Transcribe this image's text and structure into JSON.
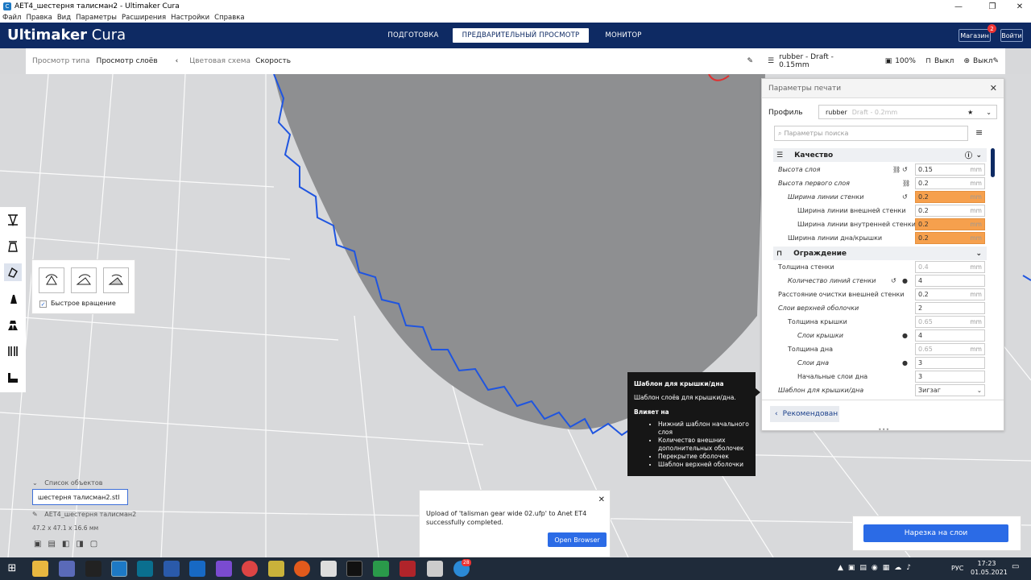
{
  "window": {
    "title": "AET4_шестерня талисман2 - Ultimaker Cura"
  },
  "menu": [
    "Файл",
    "Правка",
    "Вид",
    "Параметры",
    "Расширения",
    "Настройки",
    "Справка"
  ],
  "brand": {
    "name_bold": "Ultimaker",
    "name_light": "Cura"
  },
  "nav": {
    "prepare": "ПОДГОТОВКА",
    "preview": "ПРЕДВАРИТЕЛЬНЫЙ ПРОСМОТР",
    "monitor": "МОНИТОР"
  },
  "header_buttons": {
    "shop": "Магазин",
    "login": "Войти",
    "badge": "2"
  },
  "viewbar": {
    "view_type_label": "Просмотр типа",
    "view_type_value": "Просмотр слоёв",
    "scheme_label": "Цветовая схема",
    "scheme_value": "Скорость"
  },
  "printbar": {
    "profile": "rubber - Draft - 0.15mm",
    "infill": "100%",
    "support": "Выкл",
    "adhesion": "Выкл"
  },
  "settings": {
    "header": "Параметры печати",
    "profile_label": "Профиль",
    "profile_value": "rubber",
    "profile_sub": "Draft - 0.2mm",
    "search_placeholder": "Параметры поиска",
    "cat_quality": "Качество",
    "cat_walls": "Ограждение",
    "recommended": "Рекомендован",
    "rows": [
      {
        "name": "Высота слоя",
        "value": "0.15",
        "unit": "mm"
      },
      {
        "name": "Высота первого слоя",
        "value": "0.2",
        "unit": "mm"
      },
      {
        "name": "Ширина линии стенки",
        "value": "0.2",
        "unit": "mm"
      },
      {
        "name": "Ширина линии внешней стенки",
        "value": "0.2",
        "unit": "mm"
      },
      {
        "name": "Ширина линии внутренней стенки",
        "value": "0.2",
        "unit": "mm"
      },
      {
        "name": "Ширина линии дна/крышки",
        "value": "0.2",
        "unit": "mm"
      },
      {
        "name": "Толщина стенки",
        "value": "0.4",
        "unit": "mm"
      },
      {
        "name": "Количество линий стенки",
        "value": "4",
        "unit": ""
      },
      {
        "name": "Расстояние очистки внешней стенки",
        "value": "0.2",
        "unit": "mm"
      },
      {
        "name": "Слои верхней оболочки",
        "value": "2",
        "unit": ""
      },
      {
        "name": "Толщина крышки",
        "value": "0.65",
        "unit": "mm"
      },
      {
        "name": "Слои крышки",
        "value": "4",
        "unit": ""
      },
      {
        "name": "Толщина дна",
        "value": "0.65",
        "unit": "mm"
      },
      {
        "name": "Слои дна",
        "value": "3",
        "unit": ""
      },
      {
        "name": "Начальные слои дна",
        "value": "3",
        "unit": ""
      },
      {
        "name": "Шаблон для крышки/дна",
        "value": "Зигзаг",
        "unit": ""
      }
    ]
  },
  "tooltip": {
    "title": "Шаблон для крышки/дна",
    "desc": "Шаблон слоёв для крышки/дна.",
    "affects": "Влияет на",
    "items": [
      "Нижний шаблон начального слоя",
      "Количество внешних дополнительных оболочек",
      "Перекрытие оболочек",
      "Шаблон верхней оболочки"
    ]
  },
  "rotate": {
    "checkbox": "Быстрое вращение"
  },
  "objects": {
    "header": "Список объектов",
    "file": "шестерня талисман2.stl",
    "name": "AET4_шестерня талисман2",
    "dims": "47.2 x 47.1 x 16.6 мм"
  },
  "notification": {
    "text": "Upload of 'talisman gear wide 02.ufp' to Anet ET4 successfully completed.",
    "button": "Open Browser"
  },
  "slice": {
    "button": "Нарезка на слои"
  },
  "taskbar": {
    "lang": "РУС",
    "time": "17:23",
    "date": "01.05.2021",
    "mail_badge": "28"
  }
}
